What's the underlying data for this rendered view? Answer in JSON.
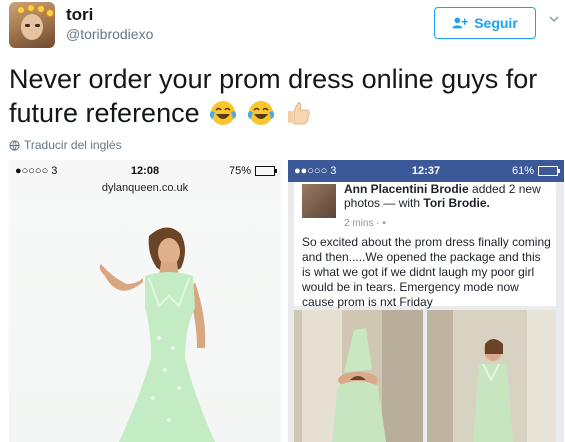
{
  "user": {
    "name": "tori",
    "handle": "@toribrodiexo"
  },
  "follow_button": {
    "label": "Seguir"
  },
  "tweet": {
    "text": "Never order your prom dress online guys for future reference",
    "emojis": [
      "face-with-tears-of-joy",
      "face-with-tears-of-joy",
      "thumbs-up"
    ]
  },
  "translate": {
    "label": "Traducir del inglés"
  },
  "left_screenshot": {
    "carrier": "●○○○○ 3",
    "time": "12:08",
    "battery": "75%",
    "battery_level": 0.75,
    "url": "dylanqueen.co.uk"
  },
  "right_screenshot": {
    "carrier": "●●○○○ 3",
    "time": "12:37",
    "battery": "61%",
    "battery_level": 0.61,
    "header_name": "Ann Placentini Brodie",
    "header_action": "added 2 new photos — with",
    "header_tagged": "Tori Brodie.",
    "time_ago": "2 mins · ",
    "body": "So excited about the prom dress finally coming and then.....We opened the package and this is what we got if we didnt laugh my poor girl would be in tears.  Emergency mode now cause prom is nxt Friday"
  },
  "colors": {
    "accent": "#1da1f2",
    "facebook": "#3b5998",
    "dress": "#bfe8c3"
  }
}
